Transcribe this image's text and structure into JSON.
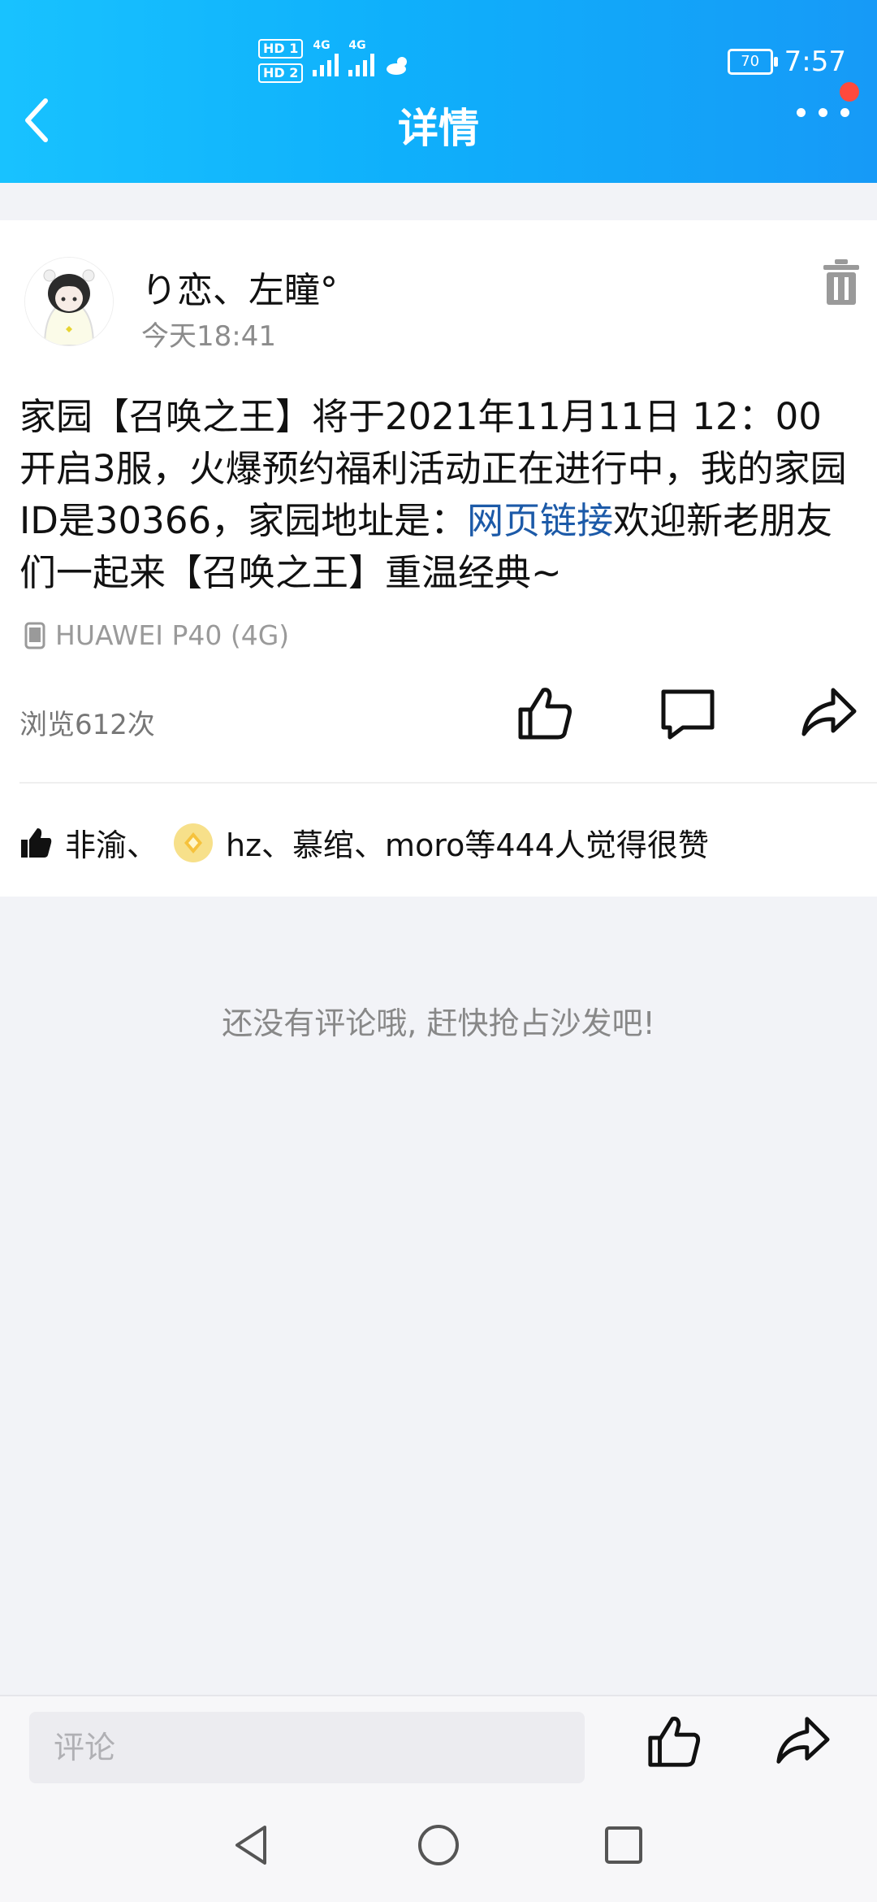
{
  "status_bar": {
    "hd1": "HD 1",
    "hd2": "HD 2",
    "net1": "4G",
    "net2": "4G",
    "battery": "70",
    "time": "7:57"
  },
  "header": {
    "title": "详情",
    "back_icon": "chevron-left-icon",
    "more_icon": "more-horizontal-icon",
    "notification_dot_color": "#ff4a3d"
  },
  "post": {
    "username": "り恋、左瞳°",
    "time": "今天18:41",
    "content_before_link": "家园【召唤之王】将于2021年11月11日 12：00开启3服，火爆预约福利活动正在进行中，我的家园ID是30366，家园地址是：",
    "link_text": "网页链接",
    "content_after_link": "欢迎新老朋友们一起来【召唤之王】重温经典~",
    "device": "HUAWEI P40 (4G)",
    "views": "浏览612次",
    "likes_part1": "非渝、",
    "likes_part2": "hz、慕绾、moro等444人觉得很赞",
    "link_color": "#1c5aa8"
  },
  "comments": {
    "empty_text": "还没有评论哦, 赶快抢占沙发吧!"
  },
  "bottom_bar": {
    "comment_placeholder": "评论"
  },
  "accent": "#11aaf9"
}
